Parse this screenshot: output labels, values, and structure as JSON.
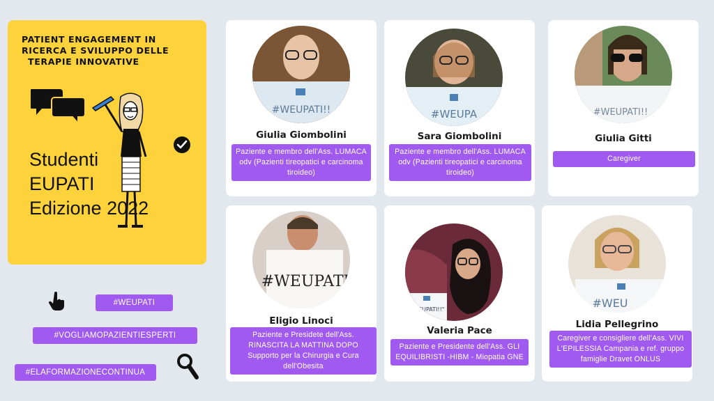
{
  "header": {
    "title_lines": [
      "PATIENT ENGAGEMENT IN",
      "RICERCA E SVILUPPO DELLE",
      "TERAPIE INNOVATIVE"
    ],
    "subtitle_lines": [
      "Studenti",
      "EUPATI",
      "Edizione 2022"
    ]
  },
  "hashtags": [
    "#WEUPATI",
    "#VOGLIAMOPAZIENTIESPERTI",
    "#ELAFORMAZIONECONTINUA"
  ],
  "cards": [
    {
      "name": "Giulia Giombolini",
      "description": "Paziente  e membro dell'Ass. LUMACA odv (Pazienti tireopatici e carcinoma tiroideo)",
      "sign_text": "#WEUPATI!!"
    },
    {
      "name": "Sara Giombolini",
      "description": "Paziente e membro dell'Ass. LUMACA odv (Pazienti tireopatici e carcinoma tiroideo)",
      "sign_text": "#WEUPA"
    },
    {
      "name": "Giulia Gitti",
      "description": "Caregiver",
      "sign_text": "#WEUPATI!!"
    },
    {
      "name": "Eligio Linoci",
      "description": "Paziente  e Presidete dell'Ass. RINASCITA LA MATTINA DOPO  Supporto  per la Chirurgia e Cura dell'Obesita",
      "sign_text": "#WEUPATI"
    },
    {
      "name": "Valeria Pace",
      "description": "Paziente e Presidente dell'Ass. GLI EQUILIBRISTI -HIBM - Miopatia GNE",
      "sign_text": "\"WEUPATI!!\""
    },
    {
      "name": "Lidia Pellegrino",
      "description": "Caregiver e consigliere dell'Ass. VIVI L'EPILESSIA Campania e ref.  gruppo famiglie Dravet  ONLUS",
      "sign_text": "#WEU"
    }
  ],
  "colors": {
    "background": "#e3e8ef",
    "panel_yellow": "#fdd23a",
    "accent_purple": "#a05af0"
  }
}
